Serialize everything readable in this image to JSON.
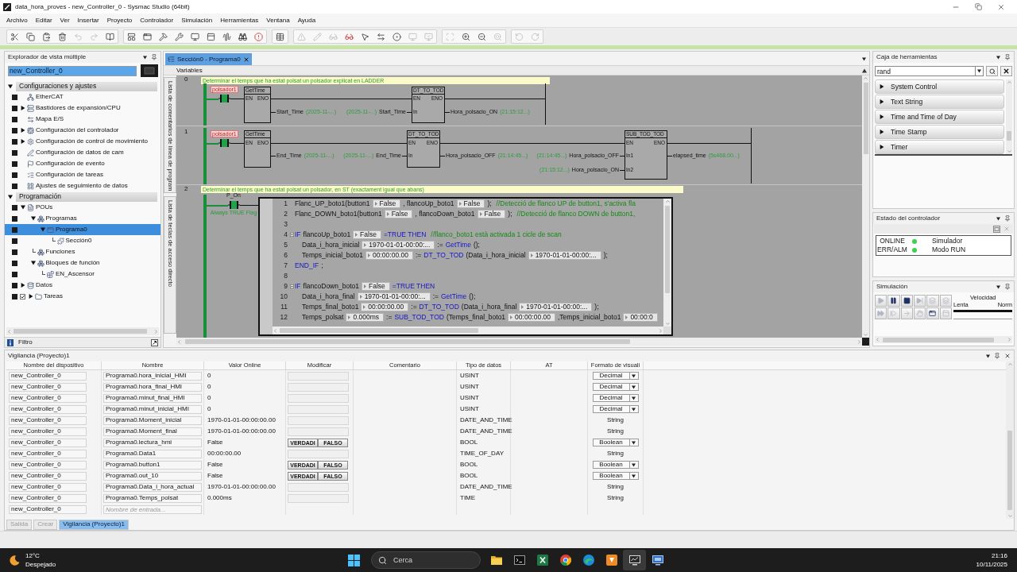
{
  "window": {
    "title": "data_hora_proves - new_Controller_0 - Sysmac Studio (64bit)"
  },
  "menu": [
    "Archivo",
    "Editar",
    "Ver",
    "Insertar",
    "Proyecto",
    "Controlador",
    "Simulación",
    "Herramientas",
    "Ventana",
    "Ayuda"
  ],
  "toolbar": [
    [
      {
        "disabled": false
      },
      {
        "disabled": false
      },
      {
        "disabled": false
      },
      {
        "disabled": false
      },
      {
        "disabled": true
      },
      {
        "disabled": true
      },
      {
        "disabled": false
      }
    ],
    [
      {
        "disabled": false
      },
      {
        "disabled": false
      },
      {
        "disabled": false
      },
      {
        "disabled": false
      },
      {
        "disabled": false
      },
      {
        "disabled": false
      },
      {
        "disabled": false
      },
      {
        "disabled": false
      },
      {
        "disabled": false
      }
    ],
    [
      {
        "disabled": false
      }
    ],
    [
      {
        "disabled": true
      },
      {
        "disabled": true
      },
      {
        "disabled": true
      },
      {
        "disabled": false
      },
      {
        "disabled": false
      },
      {
        "disabled": false
      },
      {
        "disabled": false
      },
      {
        "disabled": true
      },
      {
        "disabled": true
      }
    ],
    [
      {
        "disabled": true
      },
      {
        "disabled": false
      },
      {
        "disabled": false
      },
      {
        "disabled": true
      }
    ],
    [
      {
        "disabled": true
      },
      {
        "disabled": true
      }
    ]
  ],
  "explorer": {
    "title": "Explorador de vista múltiple",
    "controller": "new_Controller_0",
    "groups": [
      {
        "label": "Configuraciones y ajustes",
        "expanded": true,
        "items": [
          {
            "label": "EtherCAT",
            "selected": false
          },
          {
            "label": "Bastidores de expansión/CPU",
            "expanded": false,
            "selected": false
          },
          {
            "label": "Mapa E/S",
            "selected": false
          },
          {
            "label": "Configuración del controlador",
            "expanded": false,
            "selected": false
          },
          {
            "label": "Configuración de control de movimiento",
            "expanded": false,
            "selected": false
          },
          {
            "label": "Configuración de datos de cam",
            "selected": false
          },
          {
            "label": "Configuración de evento",
            "selected": false
          },
          {
            "label": "Configuración de tareas",
            "selected": false
          },
          {
            "label": "Ajustes de seguimiento de datos",
            "selected": false
          }
        ]
      },
      {
        "label": "Programación",
        "expanded": true,
        "items": [
          {
            "label": "POUs",
            "expanded": true,
            "selected": false,
            "children": [
              {
                "label": "Programas",
                "expanded": true,
                "selected": false,
                "children": [
                  {
                    "label": "Programa0",
                    "expanded": true,
                    "selected": true,
                    "children": [
                      {
                        "label": "Sección0",
                        "selected": false
                      }
                    ]
                  }
                ]
              },
              {
                "label": "Funciones",
                "selected": false
              },
              {
                "label": "Bloques de función",
                "expanded": true,
                "selected": false,
                "children": [
                  {
                    "label": "EN_Ascensor",
                    "selected": false
                  }
                ]
              }
            ]
          },
          {
            "label": "Datos",
            "expanded": false,
            "selected": false
          },
          {
            "label": "Tareas",
            "expanded": false,
            "selected": false,
            "checked": true
          }
        ]
      }
    ],
    "filter": "Filtro"
  },
  "editor": {
    "tabs": [
      {
        "label": "Sección0 - Programa0",
        "selected": true
      }
    ],
    "variables": "Variables",
    "side_tabs": [
      "Lista de comentarios de línea de program",
      "Lista de teclas de acceso directo"
    ],
    "rungs": [
      {
        "number": "0",
        "comment": "Determinar el temps que ha estat polsat un polsador explicat en LADDER",
        "contact": {
          "label": "polsador1",
          "kind": "variable",
          "energized": true
        },
        "blocks": [
          {
            "name": "GetTime",
            "en": "EN",
            "eno": "ENO",
            "outputs": [
              {
                "variable": "Start_Time",
                "value": "(2025-11-...)"
              }
            ]
          },
          {
            "name": "DT_TO_TOD",
            "en": "EN",
            "eno": "ENO",
            "inputs": [
              {
                "value": "(2025-11-...)",
                "variable": "Start_Time",
                "pin": "In"
              }
            ],
            "outputs": [
              {
                "variable": "Hora_polsacio_ON",
                "value": "(21:15:12...)"
              }
            ]
          }
        ]
      },
      {
        "number": "1",
        "contact": {
          "label": "polsador1",
          "kind": "variable",
          "energized": true
        },
        "blocks": [
          {
            "name": "GetTime",
            "en": "EN",
            "eno": "ENO",
            "outputs": [
              {
                "variable": "End_Time",
                "value": "(2025-11-...)"
              }
            ]
          },
          {
            "name": "DT_TO_TOD",
            "en": "EN",
            "eno": "ENO",
            "inputs": [
              {
                "value": "(2025-11-...)",
                "variable": "End_Time",
                "pin": "In"
              }
            ],
            "outputs": [
              {
                "variable": "Hora_polsacio_OFF",
                "value": "(21:14:45...)"
              }
            ]
          },
          {
            "name": "SUB_TOD_TOD",
            "en": "EN",
            "eno": "ENO",
            "inputs": [
              {
                "value": "(21:14:45...)",
                "variable": "Hora_polsacio_OFF",
                "pin": "In1"
              },
              {
                "value": "(21:15:12...)",
                "variable": "Hora_polsacio_ON",
                "pin": "In2"
              }
            ],
            "outputs": [
              {
                "variable": "elapsed_time",
                "value": "(5s468.00...)"
              }
            ]
          }
        ]
      },
      {
        "number": "2",
        "comment": "Determinar el temps que ha estat polsat un polsador, en ST (exactament igual que abans)",
        "contact": {
          "label": "P_On",
          "caption": "Always TRUE Flag",
          "kind": "system",
          "energized": true
        },
        "st": {
          "lines": [
            {
              "number": "1",
              "segments": [
                {
                  "kind": "text",
                  "text": "Flanc_UP_boto1(button1"
                },
                {
                  "kind": "value",
                  "text": "False"
                },
                {
                  "kind": "text",
                  "text": ", flancoUp_boto1"
                },
                {
                  "kind": "value",
                  "text": "False"
                },
                {
                  "kind": "text",
                  "text": ");"
                },
                {
                  "kind": "comment",
                  "text": "//Detecció de flanco UP de button1, s'activa fla"
                }
              ]
            },
            {
              "number": "2",
              "segments": [
                {
                  "kind": "text",
                  "text": "Flanc_DOWN_boto1(button1"
                },
                {
                  "kind": "value",
                  "text": "False"
                },
                {
                  "kind": "text",
                  "text": ", flancoDown_boto1"
                },
                {
                  "kind": "value",
                  "text": "False"
                },
                {
                  "kind": "text",
                  "text": ");"
                },
                {
                  "kind": "comment",
                  "text": "//Detecció de flanco DOWN de button1,"
                }
              ]
            },
            {
              "number": "3"
            },
            {
              "number": "4",
              "segments": [
                {
                  "kind": "keyword",
                  "text": "IF"
                },
                {
                  "kind": "text",
                  "text": "flancoUp_boto1"
                },
                {
                  "kind": "value",
                  "text": "False"
                },
                {
                  "kind": "keyword",
                  "text": "=TRUE THEN"
                },
                {
                  "kind": "comment",
                  "text": "//flanco_boto1 està activada 1 cicle de scan"
                }
              ],
              "children": [
                {
                  "number": "5",
                  "segments": [
                    {
                      "kind": "text",
                      "text": "Data_i_hora_inicial"
                    },
                    {
                      "kind": "value",
                      "text": "1970-01-01-00:00:..."
                    },
                    {
                      "kind": "text",
                      "text": ":="
                    },
                    {
                      "kind": "keyword",
                      "text": "GetTime"
                    },
                    {
                      "kind": "text",
                      "text": "();"
                    }
                  ]
                },
                {
                  "number": "6",
                  "segments": [
                    {
                      "kind": "text",
                      "text": "Temps_inicial_boto1"
                    },
                    {
                      "kind": "value",
                      "text": "00:00:00.00"
                    },
                    {
                      "kind": "text",
                      "text": ":="
                    },
                    {
                      "kind": "keyword",
                      "text": "DT_TO_TOD"
                    },
                    {
                      "kind": "text",
                      "text": "(Data_i_hora_inicial"
                    },
                    {
                      "kind": "value",
                      "text": "1970-01-01-00:00:..."
                    },
                    {
                      "kind": "text",
                      "text": ");"
                    }
                  ]
                }
              ]
            },
            {
              "number": "7",
              "segments": [
                {
                  "kind": "keyword",
                  "text": "END_IF"
                },
                {
                  "kind": "text",
                  "text": ";"
                }
              ]
            },
            {
              "number": "8"
            },
            {
              "number": "9",
              "segments": [
                {
                  "kind": "keyword",
                  "text": "IF"
                },
                {
                  "kind": "text",
                  "text": "flancoDown_boto1"
                },
                {
                  "kind": "value",
                  "text": "False"
                },
                {
                  "kind": "keyword",
                  "text": "=TRUE THEN"
                }
              ],
              "children": [
                {
                  "number": "10",
                  "segments": [
                    {
                      "kind": "text",
                      "text": "Data_i_hora_final"
                    },
                    {
                      "kind": "value",
                      "text": "1970-01-01-00:00:..."
                    },
                    {
                      "kind": "text",
                      "text": ":="
                    },
                    {
                      "kind": "keyword",
                      "text": "GetTime"
                    },
                    {
                      "kind": "text",
                      "text": "();"
                    }
                  ]
                },
                {
                  "number": "11",
                  "segments": [
                    {
                      "kind": "text",
                      "text": "Temps_final_boto1"
                    },
                    {
                      "kind": "value",
                      "text": "00:00:00.00"
                    },
                    {
                      "kind": "text",
                      "text": ":="
                    },
                    {
                      "kind": "keyword",
                      "text": "DT_TO_TOD"
                    },
                    {
                      "kind": "text",
                      "text": "(Data_i_hora_final"
                    },
                    {
                      "kind": "value",
                      "text": "1970-01-01-00:00:..."
                    },
                    {
                      "kind": "text",
                      "text": ");"
                    }
                  ]
                },
                {
                  "number": "12",
                  "segments": [
                    {
                      "kind": "text",
                      "text": "Temps_polsat"
                    },
                    {
                      "kind": "value",
                      "text": "0.000ms"
                    },
                    {
                      "kind": "text",
                      "text": ":="
                    },
                    {
                      "kind": "keyword",
                      "text": "SUB_TOD_TOD"
                    },
                    {
                      "kind": "text",
                      "text": "(Temps_final_boto1"
                    },
                    {
                      "kind": "value",
                      "text": "00:00:00.00"
                    },
                    {
                      "kind": "text",
                      "text": ",Temps_inicial_boto1"
                    },
                    {
                      "kind": "value",
                      "text": "00:00:0"
                    }
                  ]
                }
              ]
            }
          ]
        }
      }
    ]
  },
  "toolbox": {
    "title": "Caja de herramientas",
    "search": "rand",
    "items": [
      {
        "label": "System Control",
        "expanded": false
      },
      {
        "label": "Text String",
        "expanded": false
      },
      {
        "label": "Time and Time of Day",
        "expanded": false
      },
      {
        "label": "Time Stamp",
        "expanded": false
      },
      {
        "label": "Timer",
        "expanded": false
      }
    ]
  },
  "controller_status": {
    "title": "Estado del controlador",
    "rows": [
      {
        "label": "ONLINE",
        "color": "#3fcf4f",
        "value": "Simulador"
      },
      {
        "label": "ERR/ALM",
        "color": "#3fcf4f",
        "value": "Modo RUN"
      }
    ]
  },
  "simulation": {
    "title": "Simulación",
    "buttons": [
      {
        "disabled": true
      },
      {
        "disabled": false
      },
      {
        "disabled": false
      },
      {
        "disabled": true
      },
      {
        "disabled": true
      },
      {
        "disabled": true
      },
      {
        "disabled": true
      },
      {
        "disabled": true
      },
      {
        "disabled": true
      },
      {
        "disabled": true
      },
      {
        "disabled": false
      },
      {
        "disabled": true
      }
    ],
    "speed": {
      "slow": "Lenta",
      "label": "Velocidad",
      "normal": "Norm",
      "level": 1
    }
  },
  "watch": {
    "title": "Vigilancia (Proyecto)1",
    "columns": [
      "Nombre del dispositivo",
      "Nombre",
      "Valor Online",
      "Modificar",
      "Comentario",
      "Tipo de datos",
      "AT",
      "Formato de visuali"
    ],
    "rows": [
      {
        "device": "new_Controller_0",
        "name": "Programa0.hora_inicial_HMI",
        "value": "0",
        "kind": "number",
        "type": "USINT",
        "format": "Decimal"
      },
      {
        "device": "new_Controller_0",
        "name": "Programa0.hora_final_HMI",
        "value": "0",
        "kind": "number",
        "type": "USINT",
        "format": "Decimal"
      },
      {
        "device": "new_Controller_0",
        "name": "Programa0.minut_final_HMI",
        "value": "0",
        "kind": "number",
        "type": "USINT",
        "format": "Decimal"
      },
      {
        "device": "new_Controller_0",
        "name": "Programa0.minut_inicial_HMI",
        "value": "0",
        "kind": "number",
        "type": "USINT",
        "format": "Decimal"
      },
      {
        "device": "new_Controller_0",
        "name": "Programa0.Moment_inicial",
        "value": "1970-01-01-00:00:00.00",
        "kind": "text",
        "type": "DATE_AND_TIME",
        "format": "String"
      },
      {
        "device": "new_Controller_0",
        "name": "Programa0.Moment_final",
        "value": "1970-01-01-00:00:00.00",
        "kind": "text",
        "type": "DATE_AND_TIME",
        "format": "String"
      },
      {
        "device": "new_Controller_0",
        "name": "Programa0.lectura_hmi",
        "value": "False",
        "kind": "bool",
        "buttons": [
          "VERDADI",
          "FALSO"
        ],
        "type": "BOOL",
        "format": "Boolean"
      },
      {
        "device": "new_Controller_0",
        "name": "Programa0.Data1",
        "value": "00:00:00.00",
        "kind": "text",
        "type": "TIME_OF_DAY",
        "format": "String"
      },
      {
        "device": "new_Controller_0",
        "name": "Programa0.button1",
        "value": "False",
        "kind": "bool",
        "buttons": [
          "VERDADI",
          "FALSO"
        ],
        "type": "BOOL",
        "format": "Boolean"
      },
      {
        "device": "new_Controller_0",
        "name": "Programa0.out_10",
        "value": "False",
        "kind": "bool",
        "buttons": [
          "VERDADI",
          "FALSO"
        ],
        "type": "BOOL",
        "format": "Boolean"
      },
      {
        "device": "new_Controller_0",
        "name": "Programa0.Data_i_hora_actual",
        "value": "1970-01-01-00:00:00.00",
        "kind": "text",
        "type": "DATE_AND_TIME",
        "format": "String"
      },
      {
        "device": "new_Controller_0",
        "name": "Programa0.Temps_polsat",
        "value": "0.000ms",
        "kind": "text",
        "type": "TIME",
        "format": "String"
      }
    ],
    "entry": {
      "device": "new_Controller_0",
      "placeholder": "Nombre de entrada..."
    }
  },
  "bottom_tabs": [
    {
      "label": "Salida",
      "selected": false
    },
    {
      "label": "Crear",
      "selected": false
    },
    {
      "label": "Vigilancia (Proyecto)1",
      "selected": true
    }
  ],
  "taskbar": {
    "weather": {
      "temperature": "12°C",
      "condition": "Despejado"
    },
    "search": {
      "placeholder": "Cerca"
    },
    "apps": [
      {
        "selected": false
      },
      {
        "selected": false
      },
      {
        "selected": false
      },
      {
        "selected": false
      },
      {
        "selected": false
      },
      {
        "selected": false
      },
      {
        "selected": true
      },
      {
        "selected": false
      }
    ],
    "time": "21:16",
    "date": "10/11/2025"
  }
}
